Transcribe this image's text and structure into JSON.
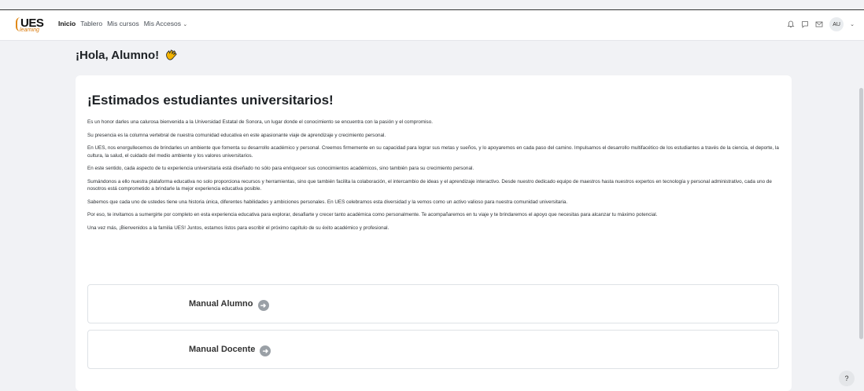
{
  "brand": {
    "name": "UES",
    "tagline": "learning"
  },
  "nav": {
    "links": [
      {
        "label": "Inicio",
        "active": true
      },
      {
        "label": "Tablero",
        "active": false
      },
      {
        "label": "Mis cursos",
        "active": false
      },
      {
        "label": "Mis Accesos",
        "active": false,
        "has_dropdown": true
      }
    ],
    "icons": [
      "bell-icon",
      "chat-icon",
      "mail-icon"
    ],
    "user_initials": "AU"
  },
  "greeting": "¡Hola, Alumno!",
  "card": {
    "title": "¡Estimados estudiantes universitarios!",
    "paragraphs": [
      "Es un honor darles una calurosa bienvenida a la Universidad Estatal de Sonora, un lugar donde el conocimiento se encuentra con la pasión y el compromiso.",
      "Su presencia es la columna vertebral de nuestra comunidad educativa en este apasionante viaje de aprendizaje y crecimiento personal.",
      "En UES, nos enorgullecemos de brindarles un ambiente que fomenta su desarrollo académico y personal. Creemos firmemente en su capacidad para lograr sus metas y sueños, y lo apoyaremos en cada paso del camino. Impulsamos el desarrollo multifacético de los estudiantes a través de la ciencia, el deporte, la cultura, la salud, el cuidado del medio ambiente y los valores universitarios.",
      "En este sentido, cada aspecto de tu experiencia universitaria está diseñado no sólo para enriquecer sus conocimientos académicos, sino también para su crecimiento personal.",
      "Sumándonos a ello nuestra plataforma educativa no solo proporciona recursos y herramientas, sino que también facilita la colaboración, el intercambio de ideas y el aprendizaje interactivo. Desde nuestro dedicado equipo de maestros hasta nuestros expertos en tecnología y personal administrativo, cada uno de nosotros está comprometido a brindarle la mejor experiencia educativa posible.",
      "Sabemos que cada uno de ustedes tiene una historia única, diferentes habilidades y ambiciones personales. En UES celebramos esta diversidad y la vemos como un activo valioso para nuestra comunidad universitaria.",
      "Por eso, te invitamos a sumergirte por completo en esta experiencia educativa para explorar, desafiarte y crecer tanto académica como personalmente. Te acompañaremos en tu viaje y te brindaremos el apoyo que necesitas para alcanzar tu máximo potencial.",
      "Una vez más, ¡Bienvenidos a la familia UES! Juntos, estamos listos para escribir el próximo capítulo de su éxito académico y profesional."
    ],
    "manuals": [
      {
        "label": "Manual Alumno"
      },
      {
        "label": "Manual Docente"
      }
    ]
  },
  "help_label": "?",
  "colors": {
    "accent": "#e0891a",
    "page_bg": "#f1f2f5",
    "card_bg": "#ffffff"
  }
}
